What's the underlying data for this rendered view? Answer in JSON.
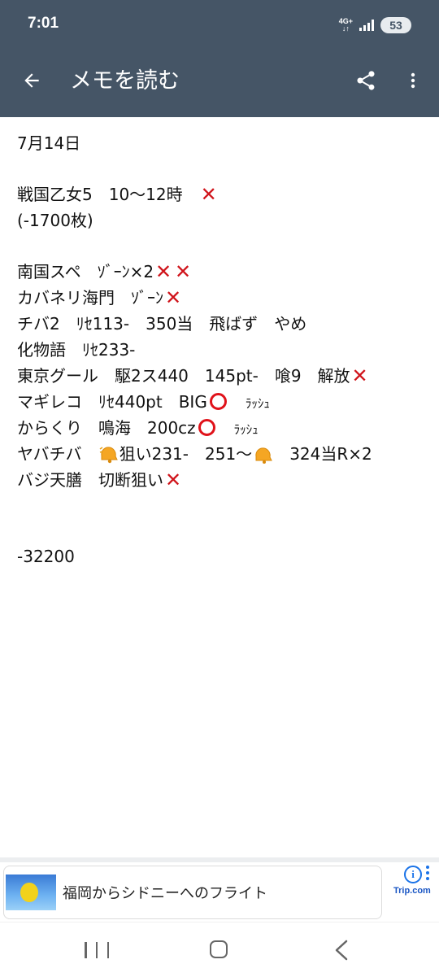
{
  "status_bar": {
    "time": "7:01",
    "network_top": "4G+",
    "network_bottom": "↓↑",
    "battery": "53"
  },
  "app_bar": {
    "title": "メモを読む"
  },
  "memo": {
    "date": "7月14日",
    "line1": "戦国乙女5　10〜12時　",
    "line2": "(-1700枚)",
    "line3": "南国スペ　ｿﾞｰﾝ×2",
    "line4": "カバネリ海門　ｿﾞｰﾝ",
    "line5": "チバ2　ﾘｾ113-　350当　飛ばず　やめ",
    "line6": "化物語　ﾘｾ233-",
    "line7": "東京グール　駆2ス440　145pt-　喰9　解放",
    "line8a": "マギレコ　ﾘｾ440pt　BIG",
    "line8b": "ﾗｯｼｭ",
    "line9a": "からくり　鳴海　200cz",
    "line9b": "ﾗｯｼｭ",
    "line10a": "ヤバチバ　",
    "line10b": "狙い231-　251〜",
    "line10c": "324当R×2",
    "line11": "バジ天膳　切断狙い",
    "total": "-32200"
  },
  "ad": {
    "text": "福岡からシドニーへのフライト",
    "brand": "Trip.com",
    "info": "i"
  },
  "icons": {
    "back": "arrow-back-icon",
    "share": "share-icon",
    "more": "more-vert-icon",
    "cross": "cross-mark-icon",
    "circle": "red-circle-icon",
    "bell": "bell-icon"
  },
  "colors": {
    "app_bar": "#455566",
    "cross": "#d0141b",
    "circle": "#e0121a",
    "ad_accent": "#1a73e8"
  }
}
